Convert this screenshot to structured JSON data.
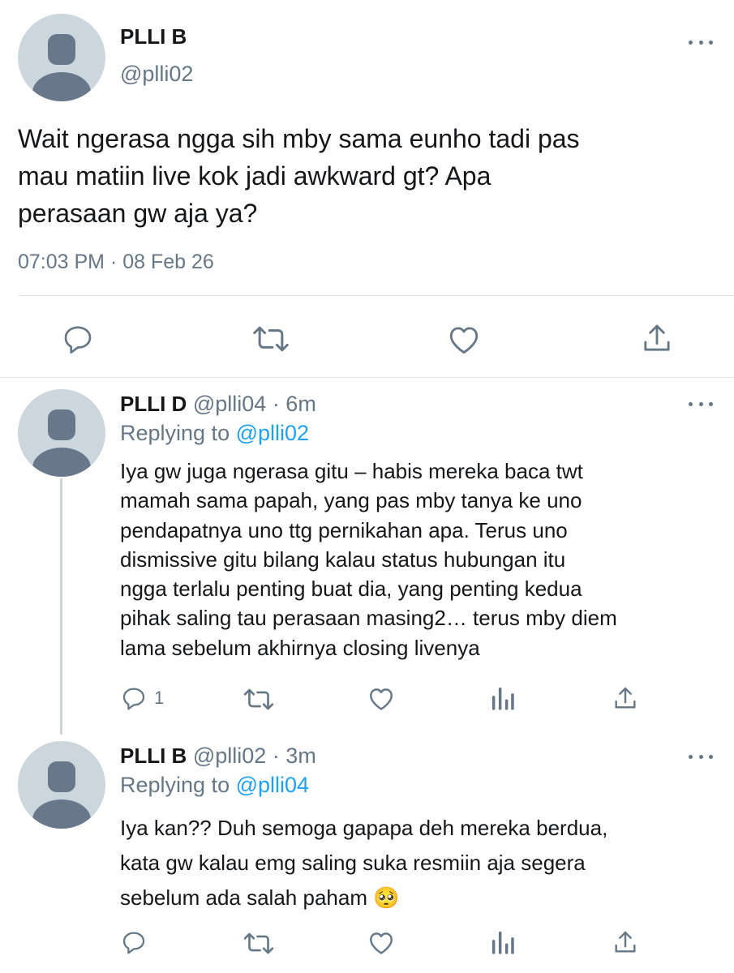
{
  "main_tweet": {
    "display_name": "PLLI B",
    "handle": "@plli02",
    "text_lines": [
      "Wait ngerasa ngga sih mby sama eunho tadi pas",
      "mau matiin live kok jadi awkward gt? Apa",
      "perasaan gw aja ya?"
    ],
    "timestamp": "07:03 PM · 08 Feb 26",
    "actions": [
      "reply-icon",
      "retweet-icon",
      "like-icon",
      "share-icon"
    ]
  },
  "replies": [
    {
      "display_name": "PLLI D",
      "handle_time": "@plli04 · 6m",
      "replying_label": "Replying to",
      "replying_handle": "@plli02",
      "text_lines": [
        "Iya gw juga ngerasa gitu – habis mereka baca twt",
        "mamah sama papah, yang pas mby tanya ke uno",
        "pendapatnya uno ttg pernikahan apa. Terus uno",
        "dismissive gitu bilang kalau status hubungan itu",
        "ngga terlalu penting buat dia, yang penting kedua",
        "pihak saling tau perasaan masing2… terus mby diem",
        "lama sebelum akhirnya closing livenya"
      ],
      "reply_count": "1",
      "actions": [
        "reply-icon",
        "retweet-icon",
        "like-icon",
        "analytics-icon",
        "share-icon"
      ]
    },
    {
      "display_name": "PLLI B",
      "handle_time": "@plli02 · 3m",
      "replying_label": "Replying to",
      "replying_handle": "@plli04",
      "text_lines": [
        "Iya kan?? Duh semoga gapapa deh mereka berdua,",
        "kata gw kalau emg saling suka resmiin aja segera",
        "sebelum ada salah paham"
      ],
      "emoji": "🥺",
      "actions": [
        "reply-icon",
        "retweet-icon",
        "like-icon",
        "analytics-icon",
        "share-icon"
      ]
    }
  ]
}
